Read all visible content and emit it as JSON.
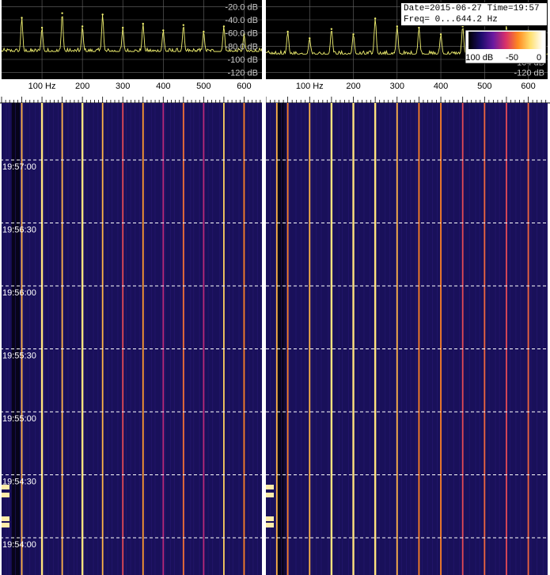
{
  "info": {
    "date_line": "Date=2015-06-27 Time=19:57",
    "freq_line": "Freq= 0...644.2 Hz"
  },
  "colors": {
    "spectrum_trace": "#f0f070",
    "grid": "#6a6a6a",
    "waterfall_bg": "#19105a",
    "time_gridline": "#ffffff",
    "strong_line": "#ffa020",
    "medium_line": "#d0406a",
    "weak_line": "#7a2a8a"
  },
  "chart_data": [
    {
      "type": "line",
      "panel": "left spectrum",
      "y_ticks": [
        "-20.0 dB",
        "-40.0 dB",
        "-60.0 dB",
        "-80.0 dB",
        "-100 dB",
        "-120 dB"
      ],
      "x_ticks": [
        "100 Hz",
        "200",
        "300",
        "400",
        "500",
        "600"
      ],
      "xlim": [
        0,
        644.2
      ],
      "ylim": [
        -130,
        -10
      ],
      "grid": true,
      "baseline_db": -88,
      "peaks": [
        {
          "freq": 50,
          "db": -37
        },
        {
          "freq": 100,
          "db": -52
        },
        {
          "freq": 150,
          "db": -30
        },
        {
          "freq": 200,
          "db": -50
        },
        {
          "freq": 250,
          "db": -32
        },
        {
          "freq": 300,
          "db": -52
        },
        {
          "freq": 350,
          "db": -46
        },
        {
          "freq": 400,
          "db": -56
        },
        {
          "freq": 450,
          "db": -48
        },
        {
          "freq": 500,
          "db": -58
        },
        {
          "freq": 550,
          "db": -50
        },
        {
          "freq": 600,
          "db": -62
        }
      ]
    },
    {
      "type": "line",
      "panel": "right spectrum",
      "y_ticks": [
        "-104 dB",
        "-120 dB"
      ],
      "x_ticks": [
        "100 Hz",
        "200",
        "300",
        "400",
        "500",
        "600"
      ],
      "xlim": [
        0,
        644.2
      ],
      "ylim": [
        -130,
        -10
      ],
      "grid": true,
      "baseline_db": -92,
      "peaks": [
        {
          "freq": 50,
          "db": -58
        },
        {
          "freq": 100,
          "db": -68
        },
        {
          "freq": 150,
          "db": -54
        },
        {
          "freq": 200,
          "db": -62
        },
        {
          "freq": 250,
          "db": -38
        },
        {
          "freq": 300,
          "db": -50
        },
        {
          "freq": 350,
          "db": -52
        },
        {
          "freq": 400,
          "db": -62
        },
        {
          "freq": 450,
          "db": -50
        },
        {
          "freq": 500,
          "db": -58
        },
        {
          "freq": 550,
          "db": -48
        },
        {
          "freq": 600,
          "db": -56
        }
      ]
    },
    {
      "type": "heatmap",
      "panel": "waterfall",
      "time_labels": [
        "19:57:00",
        "19:56:30",
        "19:56:00",
        "19:55:30",
        "19:55:00",
        "19:54:30",
        "19:54:00"
      ],
      "colorbar_labels": [
        "-100 dB",
        "-50",
        "0"
      ],
      "colorbar_range_db": [
        -100,
        0
      ],
      "colormap": [
        "#000000",
        "#1c0c6a",
        "#6a1aa0",
        "#d8306a",
        "#ff8a20",
        "#ffe070",
        "#ffffff"
      ],
      "left_lines": [
        {
          "freq": 50,
          "db": -25
        },
        {
          "freq": 100,
          "db": -15
        },
        {
          "freq": 150,
          "db": -25
        },
        {
          "freq": 200,
          "db": -15
        },
        {
          "freq": 250,
          "db": -25
        },
        {
          "freq": 300,
          "db": -45
        },
        {
          "freq": 350,
          "db": -30
        },
        {
          "freq": 400,
          "db": -55
        },
        {
          "freq": 450,
          "db": -38
        },
        {
          "freq": 500,
          "db": -55
        },
        {
          "freq": 550,
          "db": -20
        },
        {
          "freq": 600,
          "db": -35
        }
      ],
      "right_lines": [
        {
          "freq": 25,
          "db": -25
        },
        {
          "freq": 50,
          "db": -35
        },
        {
          "freq": 100,
          "db": -25
        },
        {
          "freq": 150,
          "db": -15
        },
        {
          "freq": 200,
          "db": -15
        },
        {
          "freq": 250,
          "db": -15
        },
        {
          "freq": 300,
          "db": -25
        },
        {
          "freq": 350,
          "db": -35
        },
        {
          "freq": 400,
          "db": -35
        },
        {
          "freq": 450,
          "db": -45
        },
        {
          "freq": 500,
          "db": -40
        },
        {
          "freq": 550,
          "db": -45
        },
        {
          "freq": 600,
          "db": -40
        }
      ]
    }
  ]
}
